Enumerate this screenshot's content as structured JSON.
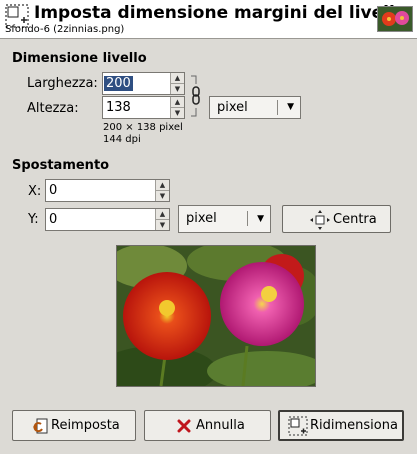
{
  "header": {
    "title": "Imposta dimensione margini del livello",
    "subtitle": "Sfondo-6 (2zinnias.png)"
  },
  "layer_size": {
    "section_title": "Dimensione livello",
    "width_label": "Larghezza:",
    "width_value": "200",
    "height_label": "Altezza:",
    "height_value": "138",
    "unit": "pixel",
    "info_size": "200 × 138 pixel",
    "info_dpi": "144 dpi",
    "chain_linked": true
  },
  "offset": {
    "section_title": "Spostamento",
    "x_label": "X:",
    "x_value": "0",
    "y_label": "Y:",
    "y_value": "0",
    "unit": "pixel",
    "center_label": "Centra"
  },
  "buttons": {
    "reset": "Reimposta",
    "cancel": "Annulla",
    "resize": "Ridimensiona"
  },
  "colors": {
    "dialog_bg": "#dcdad5",
    "header_bg": "#ffffff",
    "selection": "#2f4f82",
    "cancel_icon": "#c0161d"
  },
  "icons": [
    "layer-resize-icon",
    "image-thumbnail-icon",
    "chain-link-icon",
    "unit-dropdown-icon",
    "center-icon",
    "reset-icon",
    "cancel-icon",
    "resize-icon"
  ]
}
